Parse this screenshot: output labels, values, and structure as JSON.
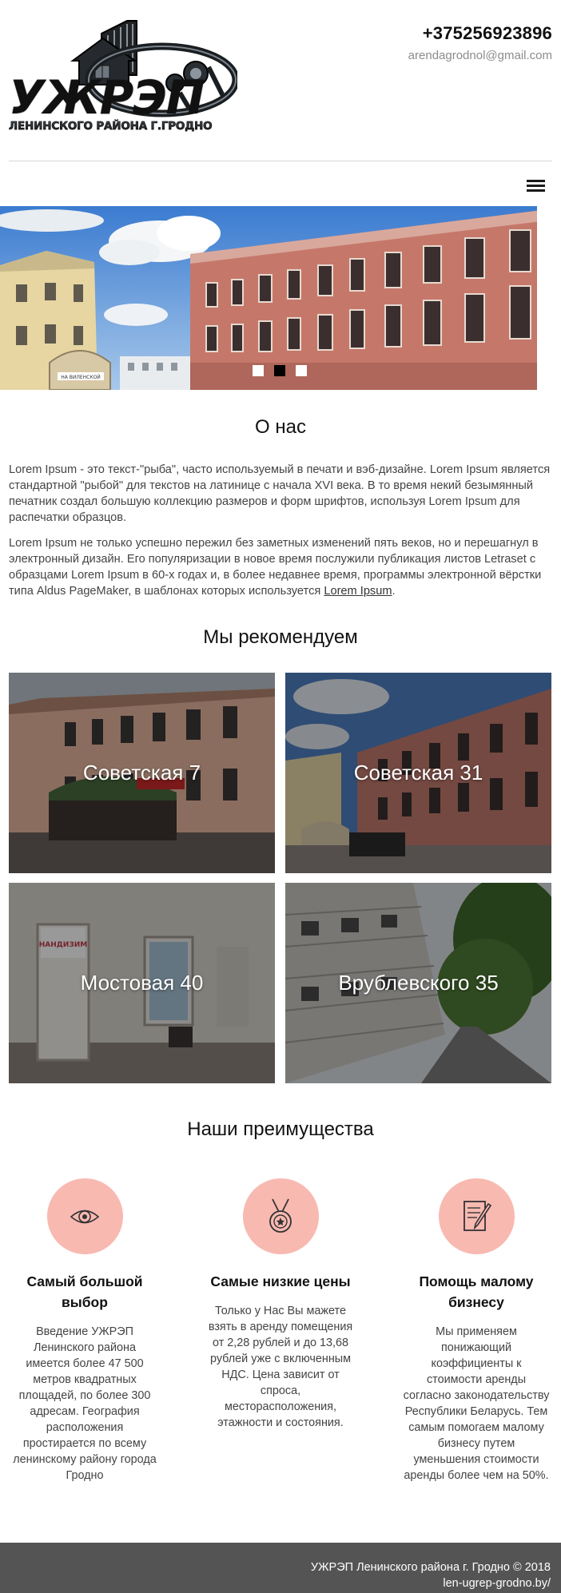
{
  "header": {
    "logo_title": "УЖРЭП",
    "logo_subtitle": "ЛЕНИНСКОГО РАЙОНА Г.ГРОДНО",
    "phone": "+375256923896",
    "email": "arendagrodnol@gmail.com",
    "menu_icon": "hamburger-menu-icon"
  },
  "slider": {
    "image": "building-street-photo",
    "sign_text": "НА ВИЛЕНСКОЙ",
    "slides_count": 3,
    "active_slide": 2
  },
  "about": {
    "title": "О нас",
    "paragraph_1": "Lorem Ipsum - это текст-\"рыба\", часто используемый в печати и вэб-дизайне. Lorem Ipsum является стандартной \"рыбой\" для текстов на латинице с начала XVI века. В то время некий безымянный печатник создал большую коллекцию размеров и форм шрифтов, используя Lorem Ipsum для распечатки образцов.",
    "paragraph_2_text": "Lorem Ipsum не только успешно пережил без заметных изменений пять веков, но и перешагнул в электронный дизайн. Его популяризации в новое время послужили публикация листов Letraset с образцами Lorem Ipsum в 60-х годах и, в более недавнее время, программы электронной вёрстки типа Aldus PageMaker, в шаблонах которых используется ",
    "paragraph_2_link": "Lorem Ipsum",
    "paragraph_2_end": "."
  },
  "recommend": {
    "title": "Мы рекомендуем",
    "cards": [
      {
        "label": "Советская 7"
      },
      {
        "label": "Советская 31"
      },
      {
        "label": "Мостовая 40"
      },
      {
        "label": "Врублевского 35"
      }
    ],
    "shop_sign": "НАНДИЗИМ"
  },
  "advantages": {
    "title": "Наши преимущества",
    "accent_color": "#f8b9b1",
    "items": [
      {
        "icon": "eye-icon",
        "title": "Самый большой выбор",
        "text": "Введение УЖРЭП Ленинского района имеется более 47 500 метров квадратных площадей, по более 300 адресам. География расположения простирается по всему ленинскому району города Гродно"
      },
      {
        "icon": "medal-icon",
        "title": "Самые низкие цены",
        "text": "Только у Нас Вы мажете взять в аренду помещения от 2,28 рублей и до 13,68 рублей уже с включенным НДС. Цена зависит от спроса, месторасположения, этажности и состояния."
      },
      {
        "icon": "document-pen-icon",
        "title": "Помощь малому бизнесу",
        "text": "Мы применяем понижающий коэффициенты к стоимости аренды согласно законодательству Республики Беларусь. Тем самым помогаем малому бизнесу путем уменьшения стоимости аренды более чем на 50%."
      }
    ]
  },
  "footer": {
    "line_1": "УЖРЭП Ленинского района г. Гродно © 2018",
    "line_2": "len-ugrep-grodno.by/",
    "background": "#545454"
  }
}
